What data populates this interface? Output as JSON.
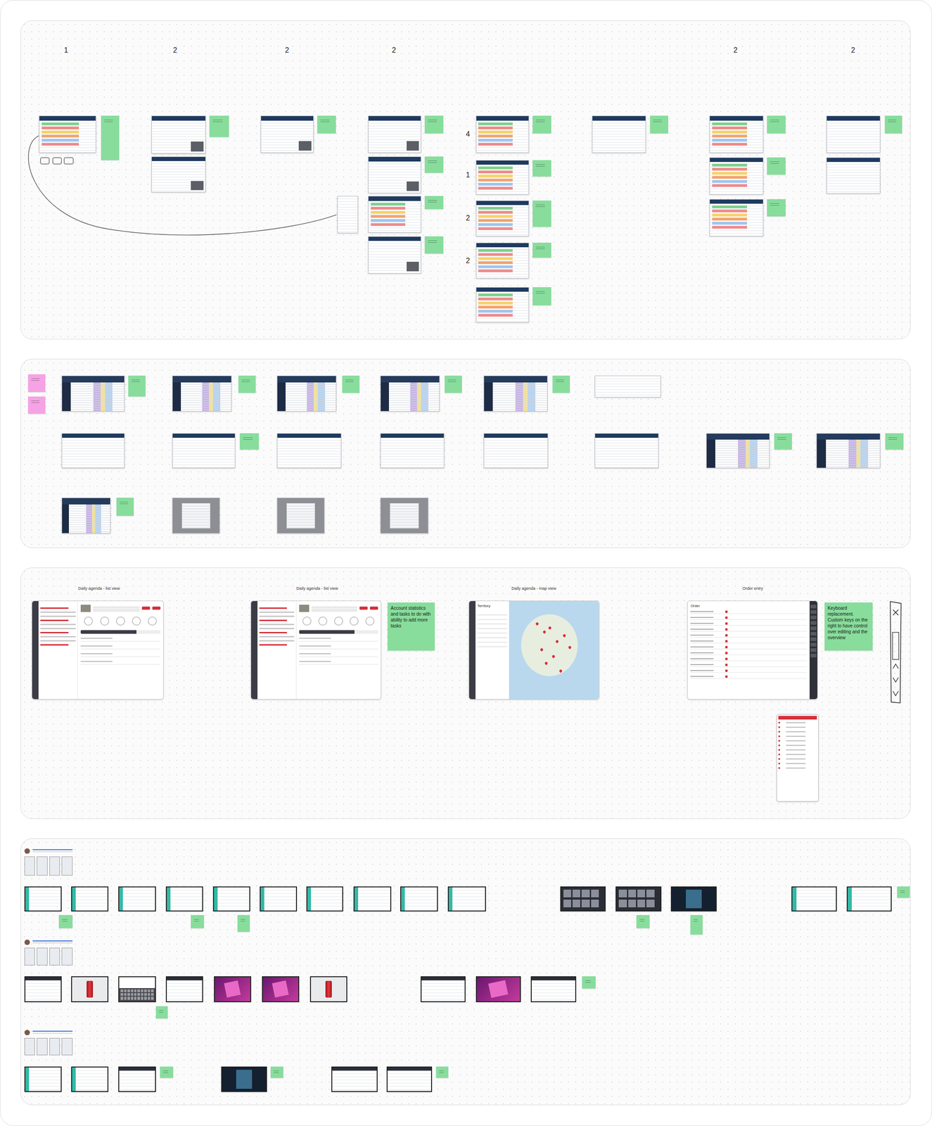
{
  "board": {
    "sections": [
      {
        "labels": [
          {
            "text": "1"
          },
          {
            "text": "2"
          },
          {
            "text": "2"
          },
          {
            "text": "2"
          },
          {
            "text": "2"
          },
          {
            "text": "2"
          },
          {
            "text": "4"
          },
          {
            "text": "1"
          },
          {
            "text": "2"
          },
          {
            "text": "2"
          }
        ],
        "titles": [],
        "frames": [
          {
            "kind": "rows"
          },
          {
            "kind": "doc"
          },
          {
            "kind": "call"
          },
          {
            "kind": "call"
          },
          {
            "kind": "call"
          },
          {
            "kind": "call"
          },
          {
            "kind": "call"
          },
          {
            "kind": "rows"
          },
          {
            "kind": "call"
          },
          {
            "kind": "rows"
          },
          {
            "kind": "rows"
          },
          {
            "kind": "rows"
          },
          {
            "kind": "rows"
          },
          {
            "kind": "rows"
          },
          {
            "kind": "app"
          },
          {
            "kind": "rows"
          },
          {
            "kind": "rows"
          },
          {
            "kind": "rows"
          },
          {
            "kind": "app"
          },
          {
            "kind": "app"
          }
        ],
        "notes": [
          {
            "color": "#88dd9c"
          },
          {
            "color": "#88dd9c"
          },
          {
            "color": "#88dd9c"
          },
          {
            "color": "#88dd9c"
          },
          {
            "color": "#88dd9c"
          },
          {
            "color": "#88dd9c"
          },
          {
            "color": "#88dd9c"
          },
          {
            "color": "#88dd9c"
          },
          {
            "color": "#88dd9c"
          },
          {
            "color": "#88dd9c"
          },
          {
            "color": "#88dd9c"
          },
          {
            "color": "#88dd9c"
          },
          {
            "color": "#88dd9c"
          },
          {
            "color": "#88dd9c"
          },
          {
            "color": "#88dd9c"
          },
          {
            "color": "#88dd9c"
          },
          {
            "color": "#88dd9c"
          }
        ]
      },
      {
        "labels": [],
        "titles": [],
        "frames": [
          {
            "kind": "grid"
          },
          {
            "kind": "grid"
          },
          {
            "kind": "grid"
          },
          {
            "kind": "grid"
          },
          {
            "kind": "grid"
          },
          {
            "kind": "doc"
          },
          {
            "kind": "app"
          },
          {
            "kind": "app"
          },
          {
            "kind": "app"
          },
          {
            "kind": "app"
          },
          {
            "kind": "app"
          },
          {
            "kind": "app"
          },
          {
            "kind": "grid"
          },
          {
            "kind": "grid"
          },
          {
            "kind": "grid"
          },
          {
            "kind": "dim"
          },
          {
            "kind": "dim"
          },
          {
            "kind": "dim"
          }
        ],
        "notes": [
          {
            "color": "#f5a3e4"
          },
          {
            "color": "#f5a3e4"
          },
          {
            "color": "#88dd9c"
          },
          {
            "color": "#88dd9c"
          },
          {
            "color": "#88dd9c"
          },
          {
            "color": "#88dd9c"
          },
          {
            "color": "#88dd9c"
          },
          {
            "color": "#88dd9c"
          },
          {
            "color": "#88dd9c"
          },
          {
            "color": "#88dd9c"
          },
          {
            "color": "#88dd9c"
          }
        ]
      },
      {
        "labels": [],
        "titles": [
          {
            "text": "Daily agenda - list view"
          },
          {
            "text": "Daily agenda - list view"
          },
          {
            "text": "Daily agenda - map view"
          },
          {
            "text": "Order entry"
          }
        ],
        "frames": [
          {
            "kind": "agenda"
          },
          {
            "kind": "agenda"
          },
          {
            "kind": "map",
            "title": "Territory"
          },
          {
            "kind": "order",
            "title": "Order"
          },
          {
            "kind": "phone"
          }
        ],
        "notes": [
          {
            "color": "#88dd9c",
            "text": "Account statistics and tasks to do with ability to add more tasks"
          },
          {
            "color": "#88dd9c",
            "text": "Keyboard replacement. Custom keys on the right to have control over editing and the overview"
          }
        ]
      },
      {
        "labels": [],
        "titles": [],
        "frames": [
          {
            "kind": "profile"
          },
          {
            "kind": "teal"
          },
          {
            "kind": "teal"
          },
          {
            "kind": "teal"
          },
          {
            "kind": "teal"
          },
          {
            "kind": "teal"
          },
          {
            "kind": "teal"
          },
          {
            "kind": "teal"
          },
          {
            "kind": "teal"
          },
          {
            "kind": "teal"
          },
          {
            "kind": "teal"
          },
          {
            "kind": "photo"
          },
          {
            "kind": "photo"
          },
          {
            "kind": "dark"
          },
          {
            "kind": "teal"
          },
          {
            "kind": "teal"
          },
          {
            "kind": "profile"
          },
          {
            "kind": "web"
          },
          {
            "kind": "product"
          },
          {
            "kind": "keyboard"
          },
          {
            "kind": "web"
          },
          {
            "kind": "purple"
          },
          {
            "kind": "purple"
          },
          {
            "kind": "product"
          },
          {
            "kind": "web"
          },
          {
            "kind": "purple"
          },
          {
            "kind": "web"
          },
          {
            "kind": "profile"
          },
          {
            "kind": "teal"
          },
          {
            "kind": "teal"
          },
          {
            "kind": "web"
          },
          {
            "kind": "dark"
          },
          {
            "kind": "web"
          },
          {
            "kind": "web"
          }
        ],
        "notes": [
          {
            "color": "#88dd9c"
          },
          {
            "color": "#88dd9c"
          },
          {
            "color": "#88dd9c"
          },
          {
            "color": "#88dd9c"
          },
          {
            "color": "#88dd9c"
          },
          {
            "color": "#88dd9c"
          },
          {
            "color": "#88dd9c"
          },
          {
            "color": "#88dd9c"
          },
          {
            "color": "#88dd9c"
          },
          {
            "color": "#88dd9c"
          },
          {
            "color": "#88dd9c"
          }
        ]
      }
    ]
  }
}
